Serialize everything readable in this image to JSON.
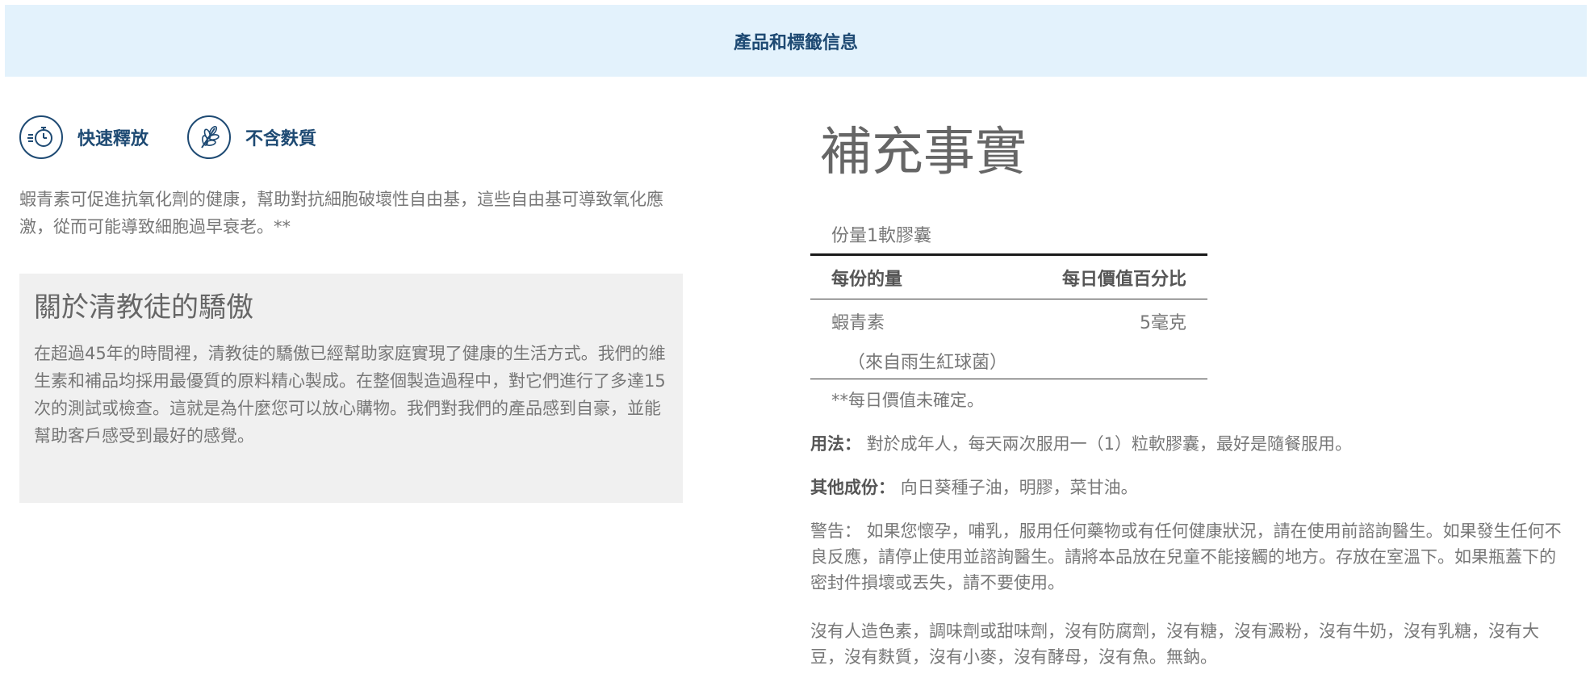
{
  "banner": {
    "title": "產品和標籤信息"
  },
  "features": [
    {
      "icon": "stopwatch-icon",
      "label": "快速釋放"
    },
    {
      "icon": "wheat-icon",
      "label": "不含麩質"
    }
  ],
  "intro": "蝦青素可促進抗氧化劑的健康，幫助對抗細胞破壞性自由基，這些自由基可導致氧化應激，從而可能導致細胞過早衰老。**",
  "about": {
    "heading": "關於清教徒的驕傲",
    "body": "在超過45年的時間裡，清教徒的驕傲已經幫助家庭實現了健康的生活方式。我們的維生素和補品均採用最優質的原料精心製成。在整個製造過程中，對它們進行了多達15次的測試或檢查。這就是為什麼您可以放心購物。我們對我們的產品感到自豪，並能幫助客戶感受到最好的感覺。"
  },
  "supplement": {
    "title": "補充事實",
    "serving": "份量1軟膠囊",
    "col_amount": "每份的量",
    "col_dv": "每日價值百分比",
    "ingredient": "蝦青素",
    "ingredient_amount": "5毫克",
    "ingredient_source": "（來自雨生紅球菌）",
    "dv_note": "**每日價值未確定。"
  },
  "usage": {
    "label": "用法：",
    "text": "對於成年人，每天兩次服用一（1）粒軟膠囊，最好是隨餐服用。"
  },
  "other": {
    "label": "其他成份：",
    "text": "向日葵種子油，明膠，菜甘油。"
  },
  "warning": "警告： 如果您懷孕，哺乳，服用任何藥物或有任何健康狀況，請在使用前諮詢醫生。如果發生任何不良反應，請停止使用並諮詢醫生。請將本品放在兒童不能接觸的地方。存放在室溫下。如果瓶蓋下的密封件損壞或丟失，請不要使用。",
  "free_from": "沒有人造色素，調味劑或甜味劑，沒有防腐劑，沒有糖，沒有澱粉，沒有牛奶，沒有乳糖，沒有大豆，沒有麩質，沒有小麥，沒有酵母，沒有魚。無鈉。",
  "colors": {
    "banner_bg": "#e3f2fc",
    "brand_blue": "#1e4a73",
    "panel_bg": "#f0f0f0"
  }
}
